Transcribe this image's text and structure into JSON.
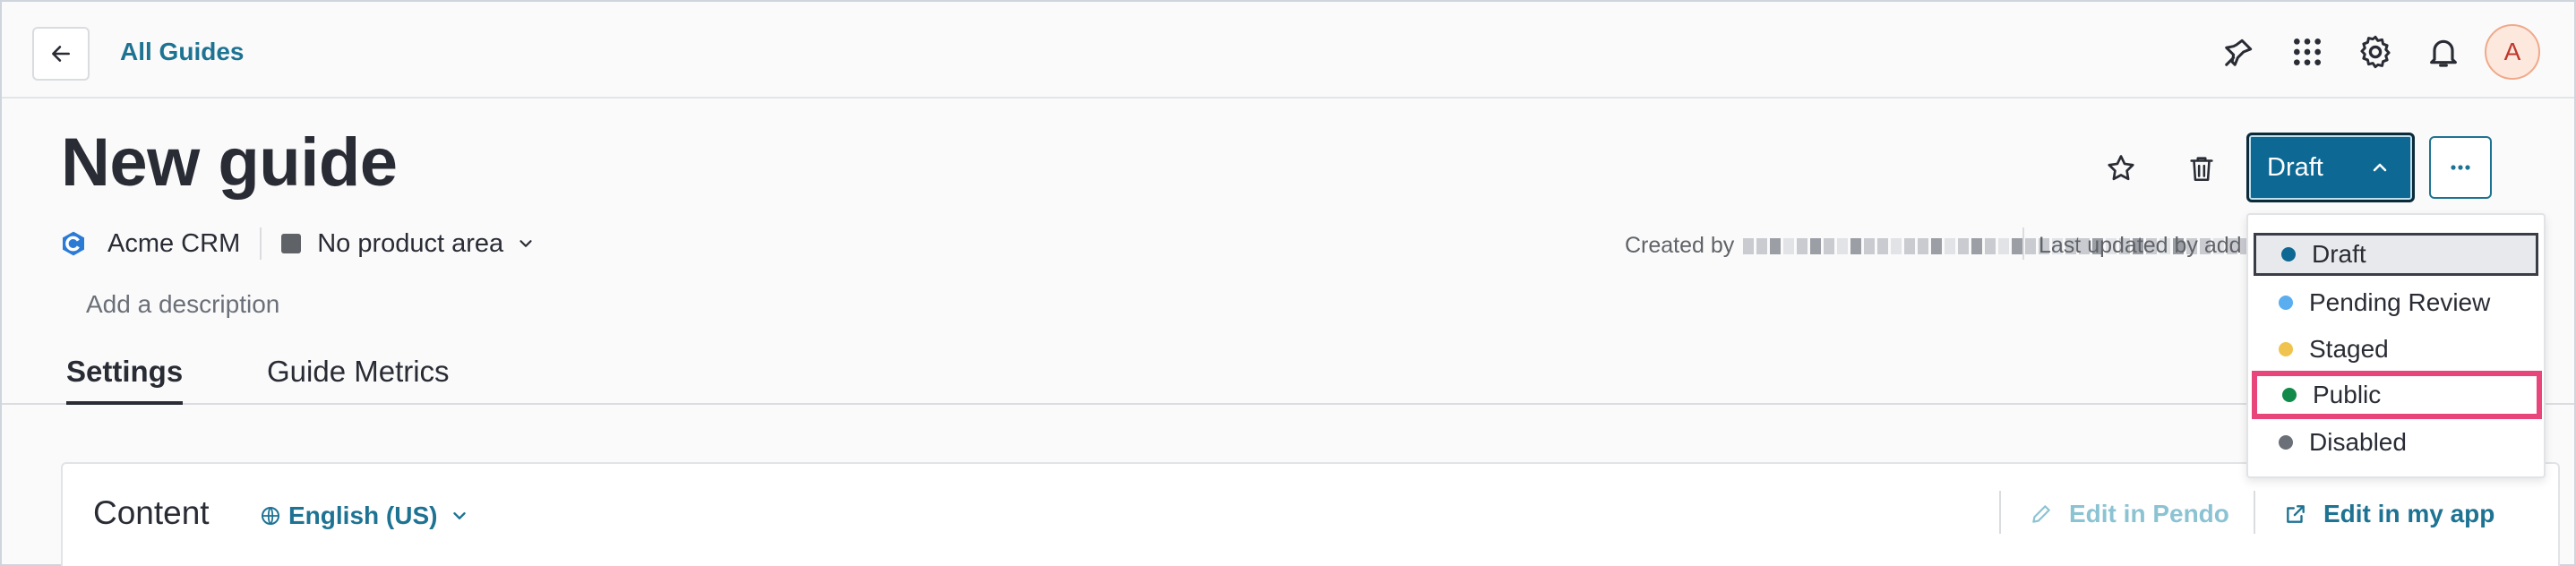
{
  "topbar": {
    "back_label": "Back",
    "breadcrumb": "All Guides",
    "icons": [
      "announcement-icon",
      "apps-grid-icon",
      "settings-gear-icon",
      "notification-bell-icon"
    ],
    "avatar_initial": "A"
  },
  "header": {
    "title": "New guide",
    "app_name": "Acme CRM",
    "product_area": "No product area",
    "description_placeholder": "Add a description",
    "created_by_label": "Created by",
    "last_updated_label": "Last updated by add"
  },
  "status_button": {
    "label": "Draft"
  },
  "status_menu": {
    "items": [
      {
        "label": "Draft",
        "color": "#0d6894"
      },
      {
        "label": "Pending Review",
        "color": "#5aaef0"
      },
      {
        "label": "Staged",
        "color": "#f0c34e"
      },
      {
        "label": "Public",
        "color": "#128a4a"
      },
      {
        "label": "Disabled",
        "color": "#6b6f78"
      }
    ],
    "selected": "Draft",
    "highlighted": "Public"
  },
  "tabs": [
    {
      "label": "Settings",
      "active": true
    },
    {
      "label": "Guide Metrics",
      "active": false
    }
  ],
  "content": {
    "title": "Content",
    "language": "English (US)",
    "edit_in_pendo": "Edit in Pendo",
    "edit_in_app": "Edit in my app"
  },
  "colors": {
    "accent": "#1e7393",
    "primary_button": "#0d6894",
    "highlight_outline": "#e8457a"
  }
}
